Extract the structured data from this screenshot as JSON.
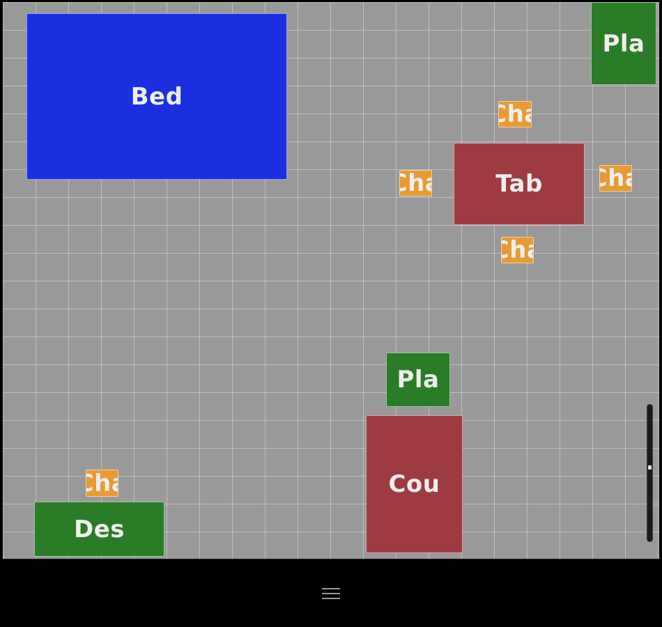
{
  "canvas": {
    "grid_color": "#ffffff",
    "background_color": "#999999"
  },
  "furniture": [
    {
      "id": "bed",
      "label": "Bed",
      "color": "#1a2fe0"
    },
    {
      "id": "plant-top",
      "label": "Pla",
      "color": "#2a7d26"
    },
    {
      "id": "chair-top",
      "label": "Cha",
      "color": "#e89a33"
    },
    {
      "id": "chair-left",
      "label": "Cha",
      "color": "#e89a33"
    },
    {
      "id": "table",
      "label": "Tab",
      "color": "#9e3b41"
    },
    {
      "id": "chair-right",
      "label": "Cha",
      "color": "#e89a33"
    },
    {
      "id": "chair-bottom",
      "label": "Cha",
      "color": "#e89a33"
    },
    {
      "id": "plant-mid",
      "label": "Pla",
      "color": "#2a7d26"
    },
    {
      "id": "couch",
      "label": "Cou",
      "color": "#9e3b41"
    },
    {
      "id": "chair-desk",
      "label": "Cha",
      "color": "#e89a33"
    },
    {
      "id": "desk",
      "label": "Des",
      "color": "#2a7d26"
    }
  ],
  "toolbar": {
    "menu_icon": "hamburger-menu-icon"
  },
  "zoom": {
    "level_fraction": 0.46
  }
}
